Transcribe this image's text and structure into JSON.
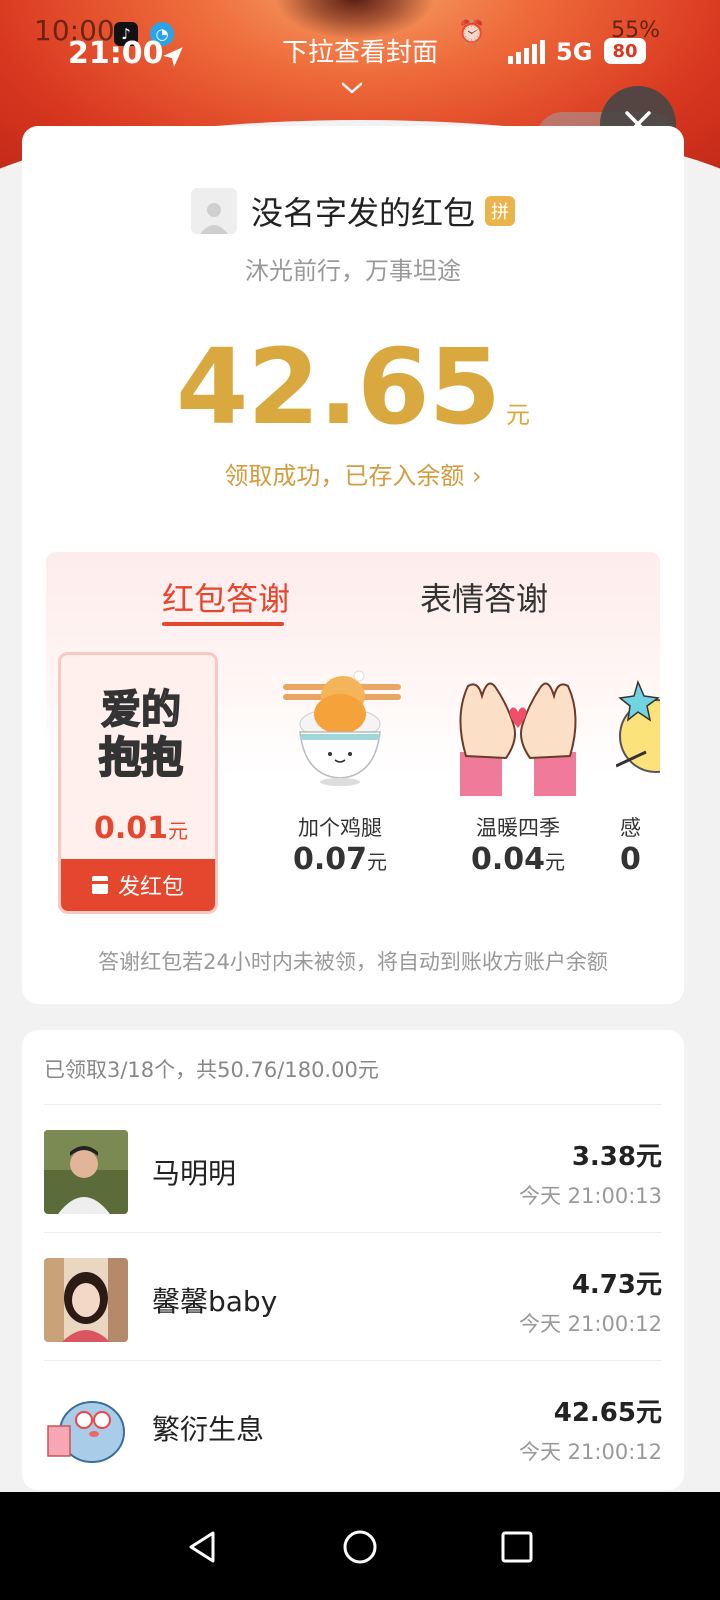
{
  "status_bar": {
    "time_back": "10:00",
    "time": "21:00",
    "title": "下拉查看封面",
    "battery_back": "55%",
    "network": "5G",
    "battery": "80"
  },
  "header": {
    "sender_name": "没名字发的红包",
    "pin_badge": "拼",
    "greeting": "沐光前行，万事坦途",
    "amount": "42.65",
    "amount_unit": "元",
    "received_text": "领取成功，已存入余额 ›"
  },
  "thanks": {
    "tabs": [
      "红包答谢",
      "表情答谢"
    ],
    "items": [
      {
        "label": "",
        "image_text_1": "爱的",
        "image_text_2": "抱抱",
        "price": "0.01",
        "unit": "元"
      },
      {
        "label": "加个鸡腿",
        "price": "0.07",
        "unit": "元"
      },
      {
        "label": "温暖四季",
        "price": "0.04",
        "unit": "元"
      },
      {
        "label": "感",
        "price": "0",
        "unit": ""
      }
    ],
    "send_button": "发红包",
    "notice": "答谢红包若24小时内未被领，将自动到账收方账户余额"
  },
  "list": {
    "summary": "已领取3/18个，共50.76/180.00元",
    "rows": [
      {
        "name": "马明明",
        "amount": "3.38元",
        "time": "今天  21:00:13"
      },
      {
        "name": "馨馨baby",
        "amount": "4.73元",
        "time": "今天  21:00:12"
      },
      {
        "name": "繁衍生息",
        "amount": "42.65元",
        "time": "今天  21:00:12"
      }
    ]
  },
  "colors": {
    "accent_red": "#e5462e",
    "gold": "#d9a93f",
    "banner": "#d8361f"
  },
  "icons": [
    "tiktok-icon",
    "browser-icon",
    "navigation-icon",
    "chevron-down-icon",
    "more-icon",
    "close-icon",
    "back-icon",
    "home-icon",
    "recents-icon"
  ]
}
